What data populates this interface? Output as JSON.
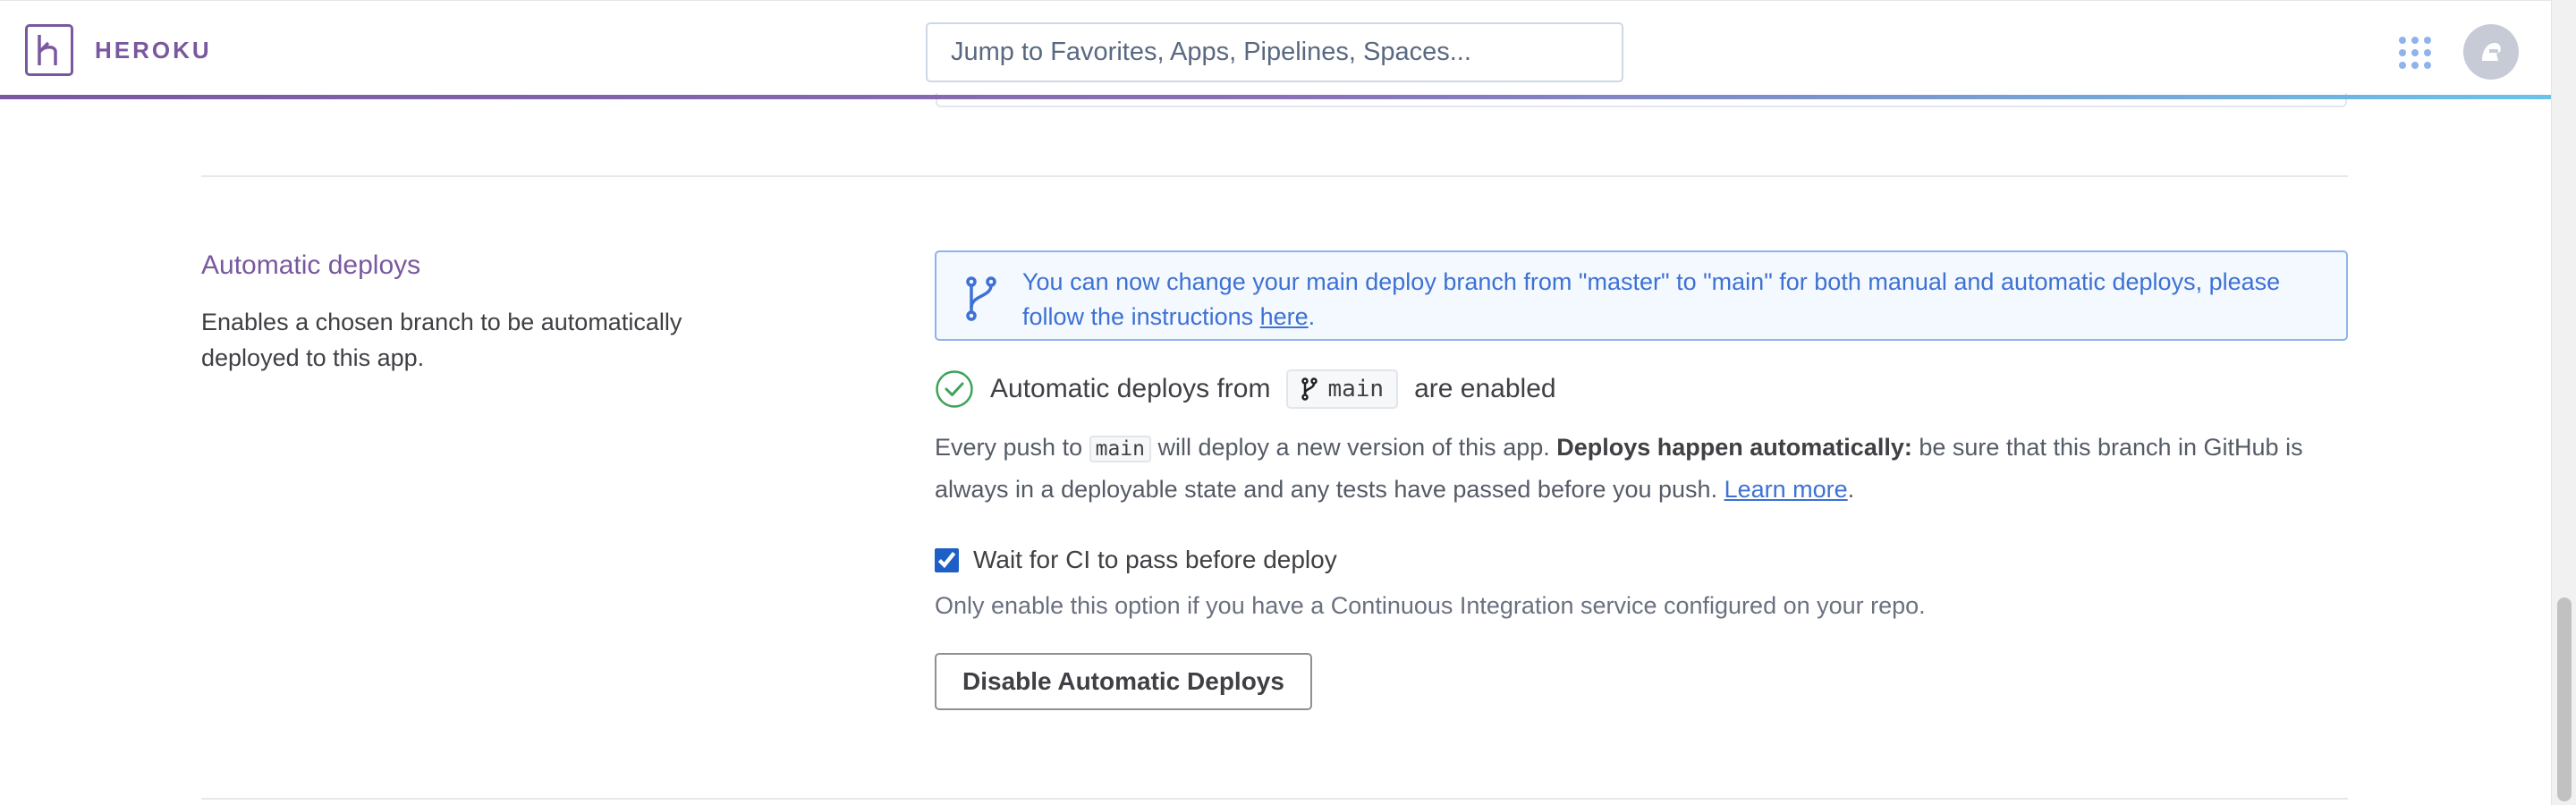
{
  "header": {
    "brand": "HEROKU",
    "search_placeholder": "Jump to Favorites, Apps, Pipelines, Spaces..."
  },
  "colors": {
    "brand": "#79589f",
    "link": "#3d71d4",
    "info_border": "#8fb3ea",
    "success": "#3da35a"
  },
  "section": {
    "title": "Automatic deploys",
    "description": "Enables a chosen branch to be automatically deployed to this app.",
    "notice": {
      "text_before": "You can now change your main deploy branch from \"master\" to \"main\" for both manual and automatic deploys, please follow the instructions ",
      "link": "here",
      "text_after": "."
    },
    "status": {
      "prefix": "Automatic deploys from",
      "branch": "main",
      "suffix": "are enabled"
    },
    "explanation": {
      "part1": "Every push to",
      "branch": "main",
      "part2": " will deploy a new version of this app. ",
      "bold": "Deploys happen automatically:",
      "part3": " be sure that this branch in GitHub is always in a deployable state and any tests have passed before you push. ",
      "link": "Learn more",
      "end": "."
    },
    "ci": {
      "label": "Wait for CI to pass before deploy",
      "checked": true,
      "help": "Only enable this option if you have a Continuous Integration service configured on your repo."
    },
    "disable_button": "Disable Automatic Deploys"
  }
}
